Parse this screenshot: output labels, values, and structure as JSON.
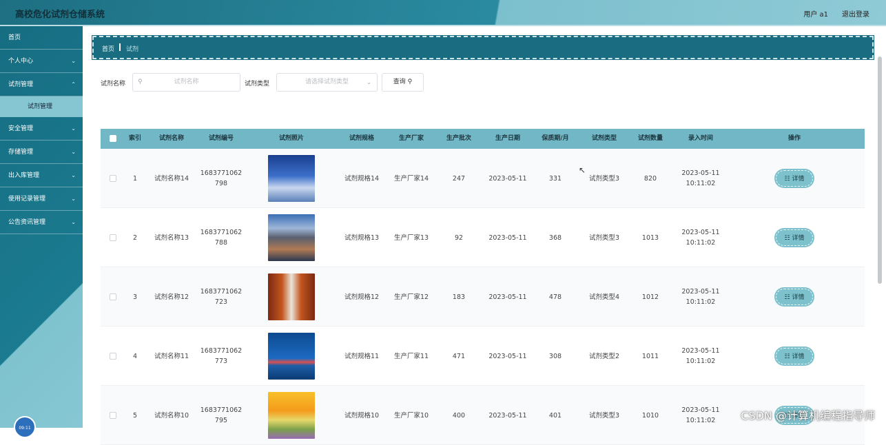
{
  "header": {
    "title": "高校危化试剂仓储系统",
    "user": "用户 a1",
    "logout": "退出登录"
  },
  "sidebar": {
    "items": [
      {
        "label": "首页",
        "has_chevron": false
      },
      {
        "label": "个人中心",
        "has_chevron": true
      },
      {
        "label": "试剂管理",
        "has_chevron": true
      },
      {
        "label": "安全管理",
        "has_chevron": true
      },
      {
        "label": "存储管理",
        "has_chevron": true
      },
      {
        "label": "出入库管理",
        "has_chevron": true
      },
      {
        "label": "使用记录管理",
        "has_chevron": true
      },
      {
        "label": "公告资讯管理",
        "has_chevron": true
      }
    ],
    "sub_item": "试剂管理",
    "clock": "09:11"
  },
  "breadcrumb": {
    "home": "首页",
    "current": "试剂"
  },
  "search": {
    "name_label": "试剂名称",
    "name_placeholder": "试剂名称",
    "type_label": "试剂类型",
    "type_placeholder": "请选择试剂类型",
    "query_button": "查询"
  },
  "table": {
    "headers": [
      "索引",
      "试剂名称",
      "试剂编号",
      "试剂照片",
      "试剂规格",
      "生产厂家",
      "生产批次",
      "生产日期",
      "保质期/月",
      "试剂类型",
      "试剂数量",
      "录入时间",
      "操作"
    ],
    "detail_label": "详情",
    "rows": [
      {
        "index": "1",
        "name": "试剂名称14",
        "code": "16837710627 98",
        "code_line1": "1683771062",
        "code_line2": "798",
        "photo": "sky-clouds",
        "spec": "试剂规格14",
        "maker": "生产厂家14",
        "batch": "247",
        "date": "2023-05-11",
        "shelf": "331",
        "type": "试剂类型3",
        "qty": "820",
        "time_line1": "2023-05-11",
        "time_line2": "10:11:02"
      },
      {
        "index": "2",
        "name": "试剂名称13",
        "code_line1": "1683771062",
        "code_line2": "788",
        "photo": "mountain-city",
        "spec": "试剂规格13",
        "maker": "生产厂家13",
        "batch": "92",
        "date": "2023-05-11",
        "shelf": "368",
        "type": "试剂类型3",
        "qty": "1013",
        "time_line1": "2023-05-11",
        "time_line2": "10:11:02"
      },
      {
        "index": "3",
        "name": "试剂名称12",
        "code_line1": "1683771062",
        "code_line2": "723",
        "photo": "corridor",
        "spec": "试剂规格12",
        "maker": "生产厂家12",
        "batch": "183",
        "date": "2023-05-11",
        "shelf": "478",
        "type": "试剂类型4",
        "qty": "1012",
        "time_line1": "2023-05-11",
        "time_line2": "10:11:02"
      },
      {
        "index": "4",
        "name": "试剂名称11",
        "code_line1": "1683771062",
        "code_line2": "773",
        "photo": "sea-umbrella",
        "spec": "试剂规格11",
        "maker": "生产厂家11",
        "batch": "471",
        "date": "2023-05-11",
        "shelf": "308",
        "type": "试剂类型2",
        "qty": "1011",
        "time_line1": "2023-05-11",
        "time_line2": "10:11:02"
      },
      {
        "index": "5",
        "name": "试剂名称10",
        "code_line1": "1683771062",
        "code_line2": "795",
        "photo": "sunset-field",
        "spec": "试剂规格10",
        "maker": "生产厂家10",
        "batch": "400",
        "date": "2023-05-11",
        "shelf": "401",
        "type": "试剂类型3",
        "qty": "1010",
        "time_line1": "2023-05-11",
        "time_line2": "10:11:02"
      }
    ]
  },
  "watermark": "CSDN @计算机编程指导师"
}
